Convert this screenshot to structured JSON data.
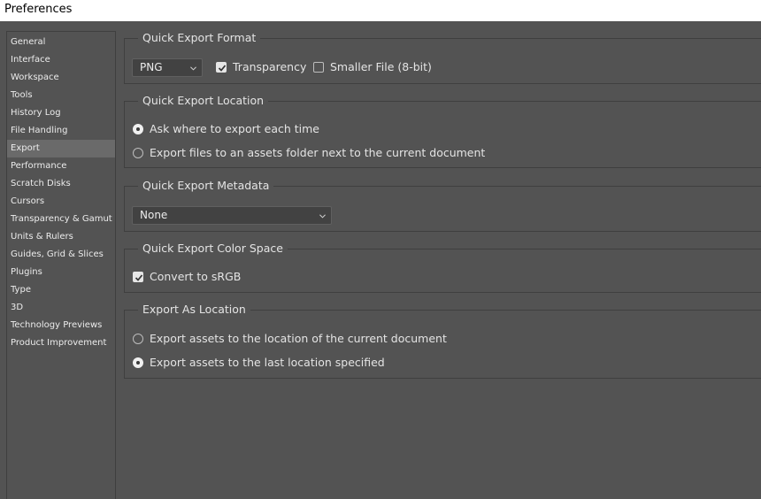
{
  "window": {
    "title": "Preferences"
  },
  "sidebar": {
    "items": [
      {
        "label": "General"
      },
      {
        "label": "Interface"
      },
      {
        "label": "Workspace"
      },
      {
        "label": "Tools"
      },
      {
        "label": "History Log"
      },
      {
        "label": "File Handling"
      },
      {
        "label": "Export",
        "selected": true
      },
      {
        "label": "Performance"
      },
      {
        "label": "Scratch Disks"
      },
      {
        "label": "Cursors"
      },
      {
        "label": "Transparency & Gamut"
      },
      {
        "label": "Units & Rulers"
      },
      {
        "label": "Guides, Grid & Slices"
      },
      {
        "label": "Plugins"
      },
      {
        "label": "Type"
      },
      {
        "label": "3D"
      },
      {
        "label": "Technology Previews"
      },
      {
        "label": "Product Improvement"
      }
    ]
  },
  "quick_export_format": {
    "title": "Quick Export Format",
    "format_value": "PNG",
    "transparency_label": "Transparency",
    "transparency_checked": true,
    "smaller_file_label": "Smaller File (8-bit)",
    "smaller_file_checked": false
  },
  "quick_export_location": {
    "title": "Quick Export Location",
    "option_ask": "Ask where to export each time",
    "option_assets_folder": "Export files to an assets folder next to the current document",
    "selected": "ask"
  },
  "quick_export_metadata": {
    "title": "Quick Export Metadata",
    "value": "None"
  },
  "quick_export_color_space": {
    "title": "Quick Export Color Space",
    "convert_label": "Convert to sRGB",
    "convert_checked": true
  },
  "export_as_location": {
    "title": "Export As Location",
    "option_current_document": "Export assets to the location of the current document",
    "option_last_location": "Export assets to the last location specified",
    "selected": "last"
  },
  "colors": {
    "panel_bg": "#535353",
    "selected_item_bg": "#6a6a6a",
    "field_bg": "#424242",
    "border": "#3f3f3f"
  }
}
